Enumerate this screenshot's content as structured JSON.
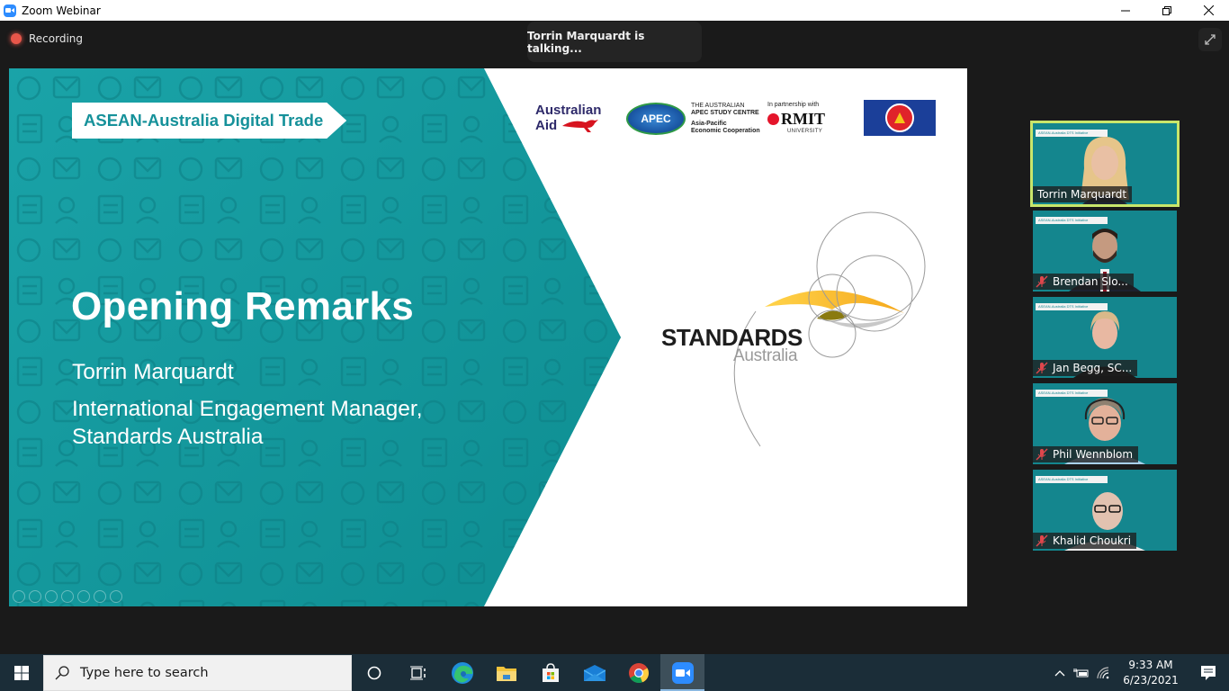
{
  "window": {
    "title": "Zoom Webinar",
    "controls": {
      "minimize": "—",
      "maximize": "❐",
      "close": "✕"
    }
  },
  "meeting": {
    "recording_label": "Recording",
    "talking_indicator": "Torrin Marquardt is talking...",
    "fullscreen_icon": "expand-icon"
  },
  "slide": {
    "program_tag": "ASEAN-Australia Digital Trade",
    "title": "Opening Remarks",
    "speaker_name": "Torrin Marquardt",
    "speaker_role_line1": "International Engagement Manager,",
    "speaker_role_line2": "Standards Australia",
    "logos": {
      "australian_aid_line1": "Australian",
      "australian_aid_line2": "Aid",
      "apec": "APEC",
      "apec_line1": "THE AUSTRALIAN",
      "apec_line2": "APEC STUDY CENTRE",
      "apec_line3": "Asia-Pacific",
      "apec_line4": "Economic Cooperation",
      "partnership": "In partnership with",
      "rmit": "RMIT",
      "rmit_sub": "UNIVERSITY"
    },
    "standards_logo_main": "STANDARDS",
    "standards_logo_sub": "Australia",
    "colors": {
      "teal": "#159aa0",
      "teal_dark": "#0f8a90",
      "tag_text": "#16919a",
      "accent_yellow": "#f5b81c"
    }
  },
  "gallery": {
    "banner_text": "ASEAN-Australia DTS Initiative",
    "participants": [
      {
        "name": "Torrin Marquardt",
        "muted": false,
        "active_speaker": true
      },
      {
        "name": "Brendan Slo...",
        "muted": true,
        "active_speaker": false
      },
      {
        "name": "Jan Begg, SC...",
        "muted": true,
        "active_speaker": false
      },
      {
        "name": "Phil Wennblom",
        "muted": true,
        "active_speaker": false
      },
      {
        "name": "Khalid Choukri",
        "muted": true,
        "active_speaker": false
      }
    ],
    "active_border_color": "#c8e66b"
  },
  "taskbar": {
    "search_placeholder": "Type here to search",
    "apps": [
      "cortana",
      "task-view",
      "edge",
      "file-explorer",
      "microsoft-store",
      "mail",
      "chrome",
      "zoom"
    ],
    "time": "9:33 AM",
    "date": "6/23/2021"
  }
}
